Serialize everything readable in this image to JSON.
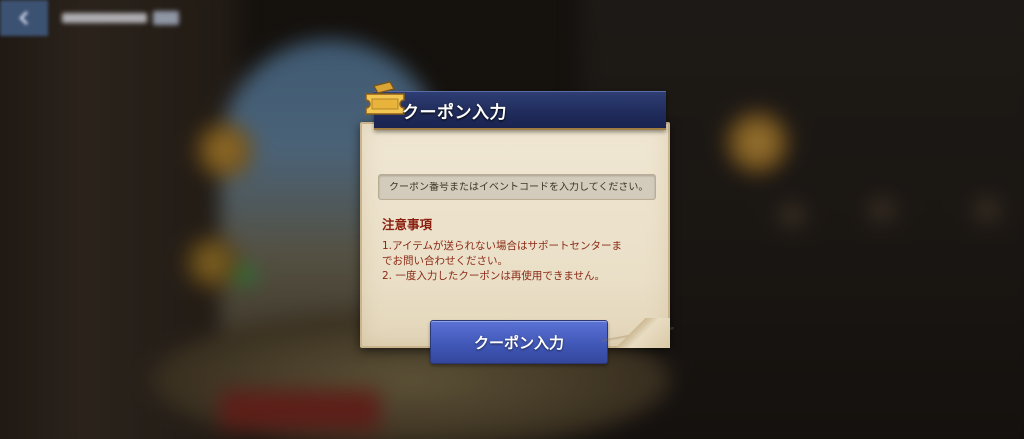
{
  "dialog": {
    "title": "クーポン入力",
    "input_placeholder": "クーポン番号またはイベントコードを入力してください。",
    "notes_title": "注意事項",
    "notes": [
      "1.アイテムが送られない場合はサポートセンターま",
      "でお問い合わせください。",
      "2. 一度入力したクーポンは再使用できません。"
    ],
    "submit_label": "クーポン入力"
  },
  "icons": {
    "ticket": "ticket-icon",
    "back": "back-arrow-icon"
  },
  "colors": {
    "header_navy": "#1f2b5a",
    "button_blue": "#4158b8",
    "notes_red": "#8a1f10",
    "paper": "#eadfc7"
  }
}
